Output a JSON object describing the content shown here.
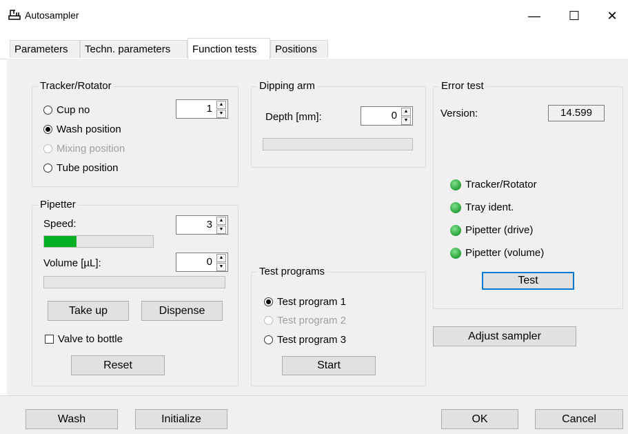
{
  "window": {
    "title": "Autosampler",
    "minimize": "—",
    "maximize": "☐",
    "close": "✕"
  },
  "tabs": [
    {
      "label": "Parameters"
    },
    {
      "label": "Techn. parameters"
    },
    {
      "label": "Function tests",
      "active": true
    },
    {
      "label": "Positions"
    }
  ],
  "tracker": {
    "legend": "Tracker/Rotator",
    "cup_no": "Cup no",
    "cup_value": "1",
    "wash": "Wash position",
    "mixing": "Mixing position",
    "tube": "Tube position",
    "selected": "wash"
  },
  "dipping": {
    "legend": "Dipping arm",
    "depth_label": "Depth [mm]:",
    "depth_value": "0",
    "progress": 0
  },
  "pipetter": {
    "legend": "Pipetter",
    "speed_label": "Speed:",
    "speed_value": "3",
    "speed_progress": 0.3,
    "volume_label": "Volume [µL]:",
    "volume_value": "0",
    "volume_progress": 0,
    "take_up": "Take up",
    "dispense": "Dispense",
    "valve": "Valve to bottle",
    "reset": "Reset"
  },
  "test_programs": {
    "legend": "Test programs",
    "p1": "Test program 1",
    "p2": "Test program 2",
    "p3": "Test program 3",
    "start": "Start"
  },
  "error_test": {
    "legend": "Error test",
    "version_label": "Version:",
    "version_value": "14.599",
    "leds": [
      "Tracker/Rotator",
      "Tray ident.",
      "Pipetter (drive)",
      "Pipetter (volume)"
    ],
    "led_color": "#2fa53e",
    "test": "Test"
  },
  "adjust": "Adjust sampler",
  "bottom": {
    "wash": "Wash",
    "initialize": "Initialize",
    "ok": "OK",
    "cancel": "Cancel"
  },
  "colors": {
    "progress": "#06b025",
    "focus": "#0078d7"
  }
}
